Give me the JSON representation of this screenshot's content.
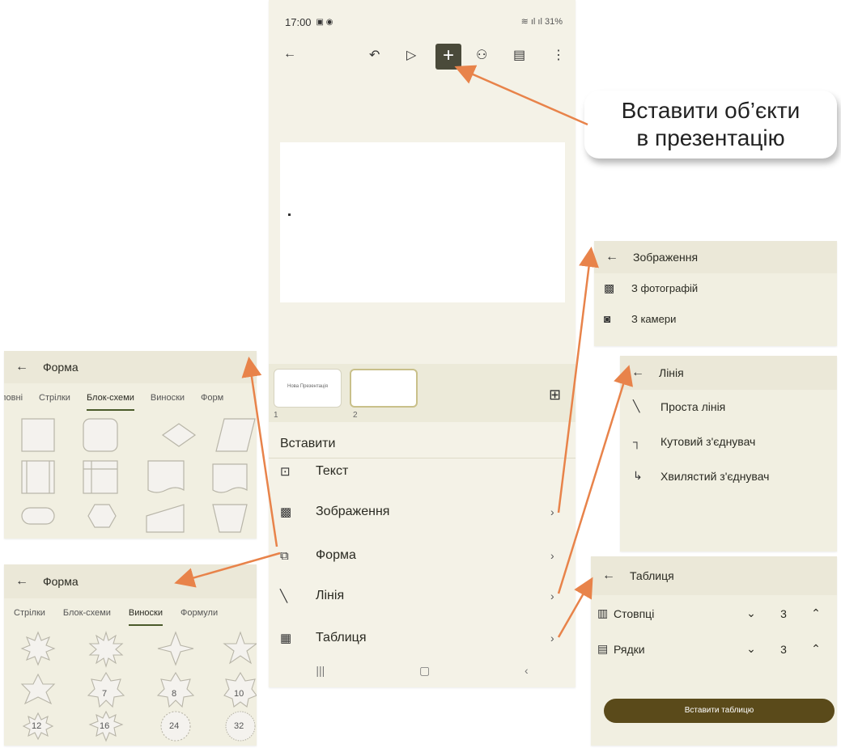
{
  "phone": {
    "time": "17:00",
    "status_right": "31%",
    "menu_title": "Вставити",
    "menu": [
      {
        "label": "Текст",
        "icon": "text-box-icon"
      },
      {
        "label": "Зображення",
        "icon": "image-icon"
      },
      {
        "label": "Форма",
        "icon": "shapes-icon"
      },
      {
        "label": "Лінія",
        "icon": "line-icon"
      },
      {
        "label": "Таблиця",
        "icon": "table-icon"
      }
    ],
    "thumb1_text": "Нова Презентація",
    "thumb1_num": "1",
    "thumb2_num": "2"
  },
  "callout": {
    "line1": "Вставити об’єкти",
    "line2": "в презентацію"
  },
  "image_panel": {
    "title": "Зображення",
    "items": [
      "З фотографій",
      "З камери"
    ]
  },
  "line_panel": {
    "title": "Лінія",
    "items": [
      "Проста лінія",
      "Кутовий з'єднувач",
      "Хвилястий з'єднувач"
    ]
  },
  "table_panel": {
    "title": "Таблиця",
    "columns_label": "Стовпці",
    "columns_value": "3",
    "rows_label": "Рядки",
    "rows_value": "3",
    "insert_label": "Вставити таблицю"
  },
  "shape_panel_1": {
    "title": "Форма",
    "tabs": [
      "ловні",
      "Стрілки",
      "Блок-схеми",
      "Виноски",
      "Форм"
    ],
    "active_tab": 2
  },
  "shape_panel_2": {
    "title": "Форма",
    "tabs": [
      "Стрілки",
      "Блок-схеми",
      "Виноски",
      "Формули"
    ],
    "active_tab": 2,
    "star_numbers": [
      "7",
      "8",
      "10",
      "12",
      "16",
      "24",
      "32"
    ]
  },
  "colors": {
    "accent_arrow": "#e8834a",
    "button_dark": "#5a4a1a",
    "panel_bg": "#f1efe1"
  }
}
